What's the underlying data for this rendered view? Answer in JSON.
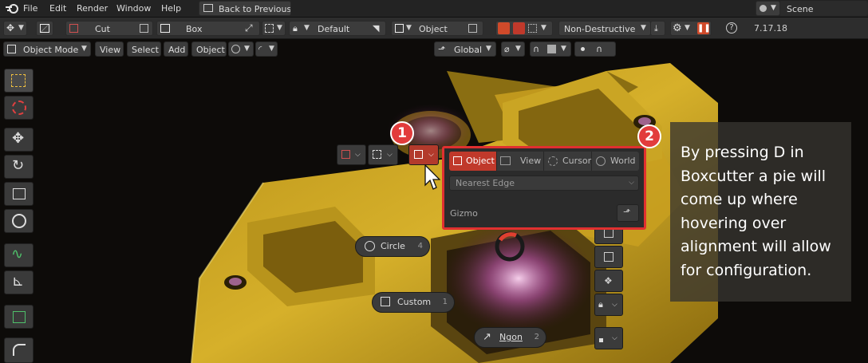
{
  "menubar": {
    "items": [
      "File",
      "Edit",
      "Render",
      "Window",
      "Help"
    ],
    "back_label": "Back to Previous",
    "scene_label": "Scene"
  },
  "toolheader": {
    "cut_label": "Cut",
    "box_label": "Box",
    "default_label": "Default",
    "object_label": "Object",
    "mode_label": "Non-Destructive",
    "version": "7.17.18"
  },
  "viewheader": {
    "mode_label": "Object Mode",
    "menu_items": [
      "View",
      "Select",
      "Add",
      "Object"
    ],
    "orientation_label": "Global"
  },
  "pie": {
    "circle_label": "Circle",
    "circle_num": "4",
    "custom_label": "Custom",
    "custom_num": "1",
    "ngon_label": "Ngon",
    "ngon_num": "2"
  },
  "popup": {
    "segments": [
      "Object",
      "View",
      "Cursor",
      "World"
    ],
    "active_segment": "Object",
    "dropdown_value": "Nearest Edge",
    "gizmo_label": "Gizmo"
  },
  "badges": [
    "1",
    "2"
  ],
  "info": {
    "text": "By pressing D in Boxcutter a pie will come up where hovering over alignment will allow for configuration."
  },
  "colors": {
    "accent_red": "#e03030",
    "active_segment": "#c0392b",
    "gold": "#c9a020"
  }
}
